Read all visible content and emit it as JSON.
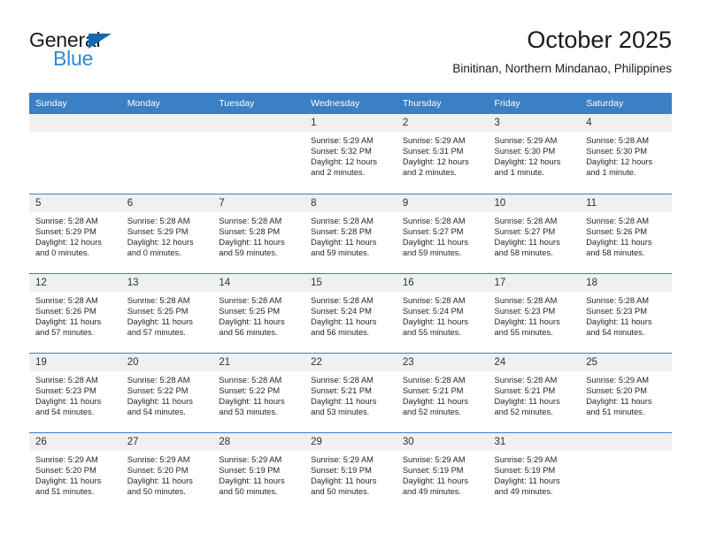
{
  "brand": {
    "name_part1": "General",
    "name_part2": "Blue",
    "triangle_color": "#1268b3",
    "blue_color": "#2f8ad4"
  },
  "header": {
    "title": "October 2025",
    "subtitle": "Binitinan, Northern Mindanao, Philippines"
  },
  "theme": {
    "header_bar": "#3b7fc4",
    "daynum_bg": "#f0f0f0",
    "text": "#262626"
  },
  "weekdays": [
    "Sunday",
    "Monday",
    "Tuesday",
    "Wednesday",
    "Thursday",
    "Friday",
    "Saturday"
  ],
  "weeks": [
    [
      {
        "day": "",
        "empty": true
      },
      {
        "day": "",
        "empty": true
      },
      {
        "day": "",
        "empty": true
      },
      {
        "day": "1",
        "sunrise": "Sunrise: 5:29 AM",
        "sunset": "Sunset: 5:32 PM",
        "daylight1": "Daylight: 12 hours",
        "daylight2": "and 2 minutes."
      },
      {
        "day": "2",
        "sunrise": "Sunrise: 5:29 AM",
        "sunset": "Sunset: 5:31 PM",
        "daylight1": "Daylight: 12 hours",
        "daylight2": "and 2 minutes."
      },
      {
        "day": "3",
        "sunrise": "Sunrise: 5:29 AM",
        "sunset": "Sunset: 5:30 PM",
        "daylight1": "Daylight: 12 hours",
        "daylight2": "and 1 minute."
      },
      {
        "day": "4",
        "sunrise": "Sunrise: 5:28 AM",
        "sunset": "Sunset: 5:30 PM",
        "daylight1": "Daylight: 12 hours",
        "daylight2": "and 1 minute."
      }
    ],
    [
      {
        "day": "5",
        "sunrise": "Sunrise: 5:28 AM",
        "sunset": "Sunset: 5:29 PM",
        "daylight1": "Daylight: 12 hours",
        "daylight2": "and 0 minutes."
      },
      {
        "day": "6",
        "sunrise": "Sunrise: 5:28 AM",
        "sunset": "Sunset: 5:29 PM",
        "daylight1": "Daylight: 12 hours",
        "daylight2": "and 0 minutes."
      },
      {
        "day": "7",
        "sunrise": "Sunrise: 5:28 AM",
        "sunset": "Sunset: 5:28 PM",
        "daylight1": "Daylight: 11 hours",
        "daylight2": "and 59 minutes."
      },
      {
        "day": "8",
        "sunrise": "Sunrise: 5:28 AM",
        "sunset": "Sunset: 5:28 PM",
        "daylight1": "Daylight: 11 hours",
        "daylight2": "and 59 minutes."
      },
      {
        "day": "9",
        "sunrise": "Sunrise: 5:28 AM",
        "sunset": "Sunset: 5:27 PM",
        "daylight1": "Daylight: 11 hours",
        "daylight2": "and 59 minutes."
      },
      {
        "day": "10",
        "sunrise": "Sunrise: 5:28 AM",
        "sunset": "Sunset: 5:27 PM",
        "daylight1": "Daylight: 11 hours",
        "daylight2": "and 58 minutes."
      },
      {
        "day": "11",
        "sunrise": "Sunrise: 5:28 AM",
        "sunset": "Sunset: 5:26 PM",
        "daylight1": "Daylight: 11 hours",
        "daylight2": "and 58 minutes."
      }
    ],
    [
      {
        "day": "12",
        "sunrise": "Sunrise: 5:28 AM",
        "sunset": "Sunset: 5:26 PM",
        "daylight1": "Daylight: 11 hours",
        "daylight2": "and 57 minutes."
      },
      {
        "day": "13",
        "sunrise": "Sunrise: 5:28 AM",
        "sunset": "Sunset: 5:25 PM",
        "daylight1": "Daylight: 11 hours",
        "daylight2": "and 57 minutes."
      },
      {
        "day": "14",
        "sunrise": "Sunrise: 5:28 AM",
        "sunset": "Sunset: 5:25 PM",
        "daylight1": "Daylight: 11 hours",
        "daylight2": "and 56 minutes."
      },
      {
        "day": "15",
        "sunrise": "Sunrise: 5:28 AM",
        "sunset": "Sunset: 5:24 PM",
        "daylight1": "Daylight: 11 hours",
        "daylight2": "and 56 minutes."
      },
      {
        "day": "16",
        "sunrise": "Sunrise: 5:28 AM",
        "sunset": "Sunset: 5:24 PM",
        "daylight1": "Daylight: 11 hours",
        "daylight2": "and 55 minutes."
      },
      {
        "day": "17",
        "sunrise": "Sunrise: 5:28 AM",
        "sunset": "Sunset: 5:23 PM",
        "daylight1": "Daylight: 11 hours",
        "daylight2": "and 55 minutes."
      },
      {
        "day": "18",
        "sunrise": "Sunrise: 5:28 AM",
        "sunset": "Sunset: 5:23 PM",
        "daylight1": "Daylight: 11 hours",
        "daylight2": "and 54 minutes."
      }
    ],
    [
      {
        "day": "19",
        "sunrise": "Sunrise: 5:28 AM",
        "sunset": "Sunset: 5:23 PM",
        "daylight1": "Daylight: 11 hours",
        "daylight2": "and 54 minutes."
      },
      {
        "day": "20",
        "sunrise": "Sunrise: 5:28 AM",
        "sunset": "Sunset: 5:22 PM",
        "daylight1": "Daylight: 11 hours",
        "daylight2": "and 54 minutes."
      },
      {
        "day": "21",
        "sunrise": "Sunrise: 5:28 AM",
        "sunset": "Sunset: 5:22 PM",
        "daylight1": "Daylight: 11 hours",
        "daylight2": "and 53 minutes."
      },
      {
        "day": "22",
        "sunrise": "Sunrise: 5:28 AM",
        "sunset": "Sunset: 5:21 PM",
        "daylight1": "Daylight: 11 hours",
        "daylight2": "and 53 minutes."
      },
      {
        "day": "23",
        "sunrise": "Sunrise: 5:28 AM",
        "sunset": "Sunset: 5:21 PM",
        "daylight1": "Daylight: 11 hours",
        "daylight2": "and 52 minutes."
      },
      {
        "day": "24",
        "sunrise": "Sunrise: 5:28 AM",
        "sunset": "Sunset: 5:21 PM",
        "daylight1": "Daylight: 11 hours",
        "daylight2": "and 52 minutes."
      },
      {
        "day": "25",
        "sunrise": "Sunrise: 5:29 AM",
        "sunset": "Sunset: 5:20 PM",
        "daylight1": "Daylight: 11 hours",
        "daylight2": "and 51 minutes."
      }
    ],
    [
      {
        "day": "26",
        "sunrise": "Sunrise: 5:29 AM",
        "sunset": "Sunset: 5:20 PM",
        "daylight1": "Daylight: 11 hours",
        "daylight2": "and 51 minutes."
      },
      {
        "day": "27",
        "sunrise": "Sunrise: 5:29 AM",
        "sunset": "Sunset: 5:20 PM",
        "daylight1": "Daylight: 11 hours",
        "daylight2": "and 50 minutes."
      },
      {
        "day": "28",
        "sunrise": "Sunrise: 5:29 AM",
        "sunset": "Sunset: 5:19 PM",
        "daylight1": "Daylight: 11 hours",
        "daylight2": "and 50 minutes."
      },
      {
        "day": "29",
        "sunrise": "Sunrise: 5:29 AM",
        "sunset": "Sunset: 5:19 PM",
        "daylight1": "Daylight: 11 hours",
        "daylight2": "and 50 minutes."
      },
      {
        "day": "30",
        "sunrise": "Sunrise: 5:29 AM",
        "sunset": "Sunset: 5:19 PM",
        "daylight1": "Daylight: 11 hours",
        "daylight2": "and 49 minutes."
      },
      {
        "day": "31",
        "sunrise": "Sunrise: 5:29 AM",
        "sunset": "Sunset: 5:19 PM",
        "daylight1": "Daylight: 11 hours",
        "daylight2": "and 49 minutes."
      },
      {
        "day": "",
        "empty": true
      }
    ]
  ]
}
